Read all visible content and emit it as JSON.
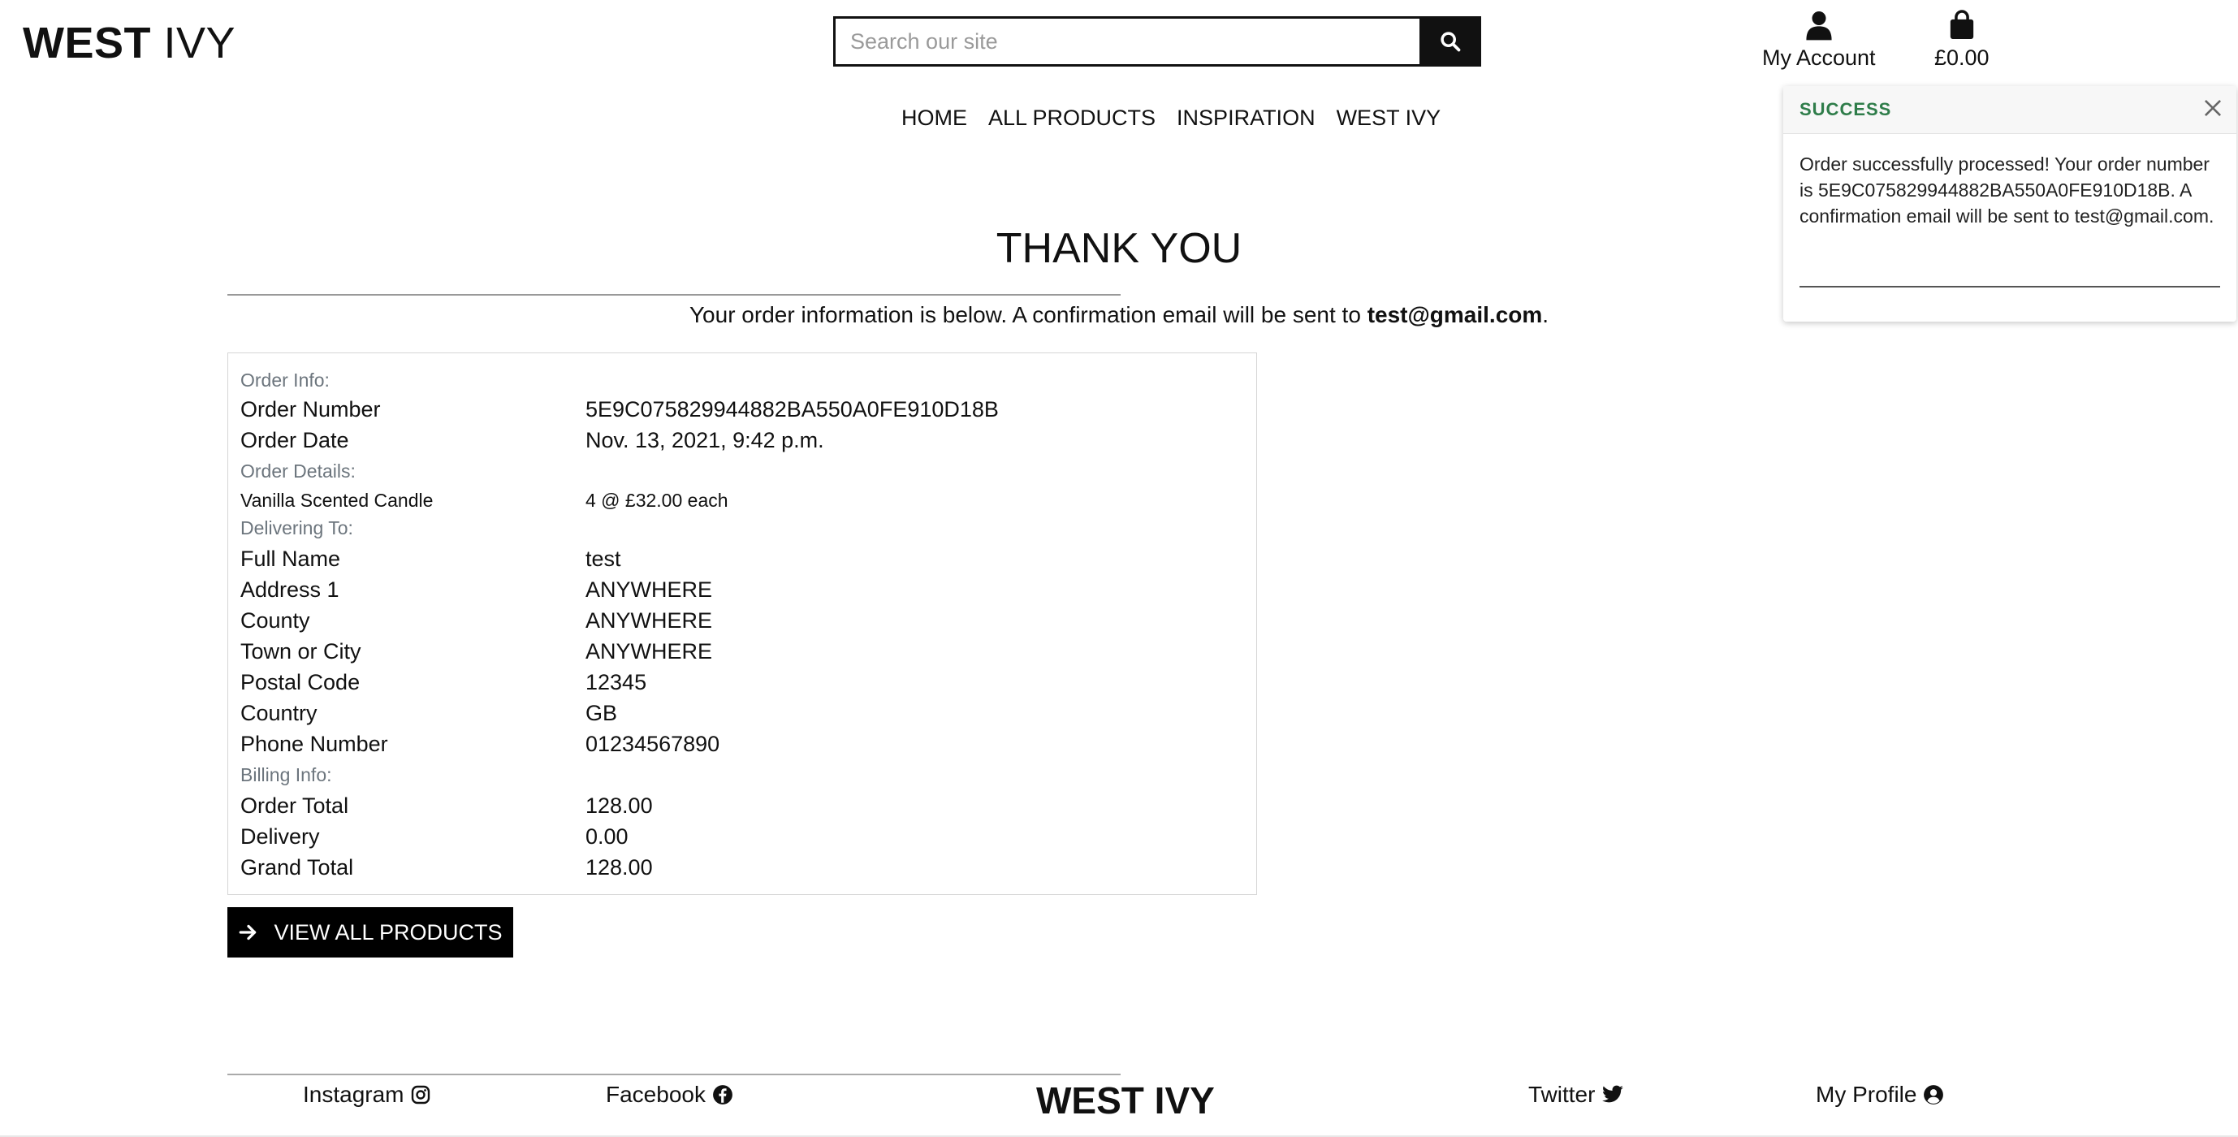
{
  "header": {
    "logo_bold": "WEST",
    "logo_rest": "IVY",
    "search_placeholder": "Search our site",
    "account_label": "My Account",
    "cart_total": "£0.00"
  },
  "nav": [
    "HOME",
    "ALL PRODUCTS",
    "INSPIRATION",
    "WEST IVY"
  ],
  "toast": {
    "title": "SUCCESS",
    "message": "Order successfully processed! Your order number is 5E9C075829944882BA550A0FE910D18B. A confirmation email will be sent to test@gmail.com."
  },
  "main": {
    "heading": "THANK YOU",
    "intro_text": "Your order information is below. A confirmation email will be sent to",
    "intro_email": "test@gmail.com",
    "intro_end": "."
  },
  "order": {
    "order_info_label": "Order Info:",
    "order_number_label": "Order Number",
    "order_number": "5E9C075829944882BA550A0FE910D18B",
    "order_date_label": "Order Date",
    "order_date": "Nov. 13, 2021, 9:42 p.m.",
    "details_label": "Order Details:",
    "item_name": "Vanilla Scented Candle",
    "item_qty": "4 @ £32.00 each",
    "delivering_label": "Delivering To:",
    "full_name_label": "Full Name",
    "full_name": "test",
    "address1_label": "Address 1",
    "address1": "ANYWHERE",
    "county_label": "County",
    "county": "ANYWHERE",
    "town_label": "Town or City",
    "town": "ANYWHERE",
    "postal_label": "Postal Code",
    "postal": "12345",
    "country_label": "Country",
    "country": "GB",
    "phone_label": "Phone Number",
    "phone": "01234567890",
    "billing_label": "Billing Info:",
    "order_total_label": "Order Total",
    "order_total": "128.00",
    "delivery_label": "Delivery",
    "delivery": "0.00",
    "grand_total_label": "Grand Total",
    "grand_total": "128.00"
  },
  "cta": {
    "label": "VIEW ALL PRODUCTS"
  },
  "footer": {
    "instagram": "Instagram",
    "facebook": "Facebook",
    "logo_bold": "WEST",
    "logo_rest": "IVY",
    "twitter": "Twitter",
    "profile": "My Profile"
  }
}
